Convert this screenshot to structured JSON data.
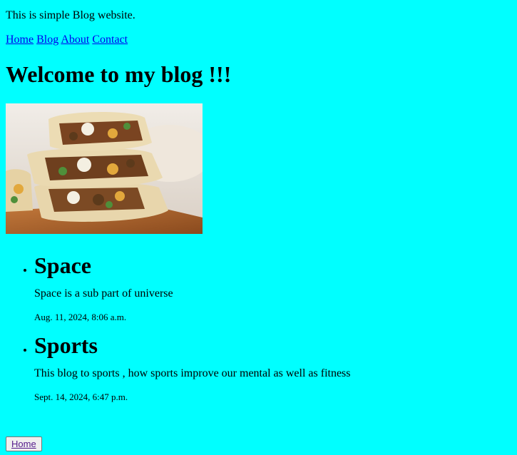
{
  "intro": "This is simple Blog website.",
  "nav": {
    "home": "Home",
    "blog": "Blog",
    "about": "About",
    "contact": "Contact"
  },
  "title": "Welcome to my blog !!!",
  "posts": [
    {
      "title": "Space",
      "description": "Space is a sub part of universe",
      "date": "Aug. 11, 2024, 8:06 a.m."
    },
    {
      "title": "Sports",
      "description": "This blog to sports , how sports improve our mental as well as fitness",
      "date": "Sept. 14, 2024, 6:47 p.m."
    }
  ],
  "footer": {
    "home_button": "Home"
  },
  "colors": {
    "background": "#00ffff",
    "link": "#0000ee"
  }
}
